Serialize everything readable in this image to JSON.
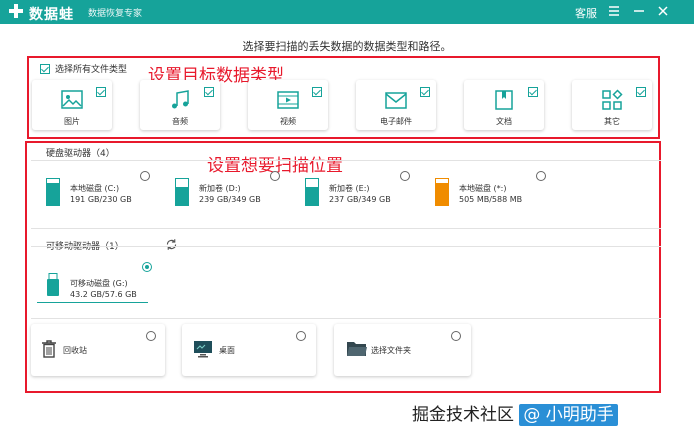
{
  "titlebar": {
    "app_name": "数据蛙",
    "subtitle": "数据恢复专家",
    "support": "客服",
    "bg_color": "#16a39a"
  },
  "instruction": "选择要扫描的丢失数据的数据类型和路径。",
  "annotations": {
    "types": "设置目标数据类型",
    "location": "设置想要扫描位置",
    "color": "#e8192c"
  },
  "file_types": {
    "select_all_label": "选择所有文件类型",
    "select_all_checked": true,
    "items": [
      {
        "label": "图片",
        "icon": "image-icon",
        "checked": true
      },
      {
        "label": "音频",
        "icon": "music-icon",
        "checked": true
      },
      {
        "label": "视频",
        "icon": "video-icon",
        "checked": true
      },
      {
        "label": "电子邮件",
        "icon": "email-icon",
        "checked": true
      },
      {
        "label": "文档",
        "icon": "document-icon",
        "checked": true
      },
      {
        "label": "其它",
        "icon": "other-icon",
        "checked": true
      }
    ]
  },
  "hard_drives": {
    "title": "硬盘驱动器（4）",
    "items": [
      {
        "name": "本地磁盘 (C:)",
        "size": "191 GB/230 GB",
        "used_fraction": 0.83,
        "color": "#16a39a",
        "selected": false
      },
      {
        "name": "新加卷 (D:)",
        "size": "239 GB/349 GB",
        "used_fraction": 0.68,
        "color": "#16a39a",
        "selected": false
      },
      {
        "name": "新加卷 (E:)",
        "size": "237 GB/349 GB",
        "used_fraction": 0.68,
        "color": "#16a39a",
        "selected": false
      },
      {
        "name": "本地磁盘 (*:)",
        "size": "505 MB/588 MB",
        "used_fraction": 0.86,
        "color": "#f08c00",
        "selected": false
      }
    ]
  },
  "removable": {
    "title": "可移动驱动器（1）",
    "refresh_icon": "refresh-icon",
    "items": [
      {
        "name": "可移动磁盘 (G:)",
        "size": "43.2 GB/57.6 GB",
        "selected": true
      }
    ]
  },
  "quick_locations": [
    {
      "label": "回收站",
      "icon": "trash-icon"
    },
    {
      "label": "桌面",
      "icon": "desktop-icon"
    },
    {
      "label": "选择文件夹",
      "icon": "folder-icon"
    }
  ],
  "watermark": {
    "text": "掘金技术社区",
    "handle": "@ 小明助手"
  }
}
